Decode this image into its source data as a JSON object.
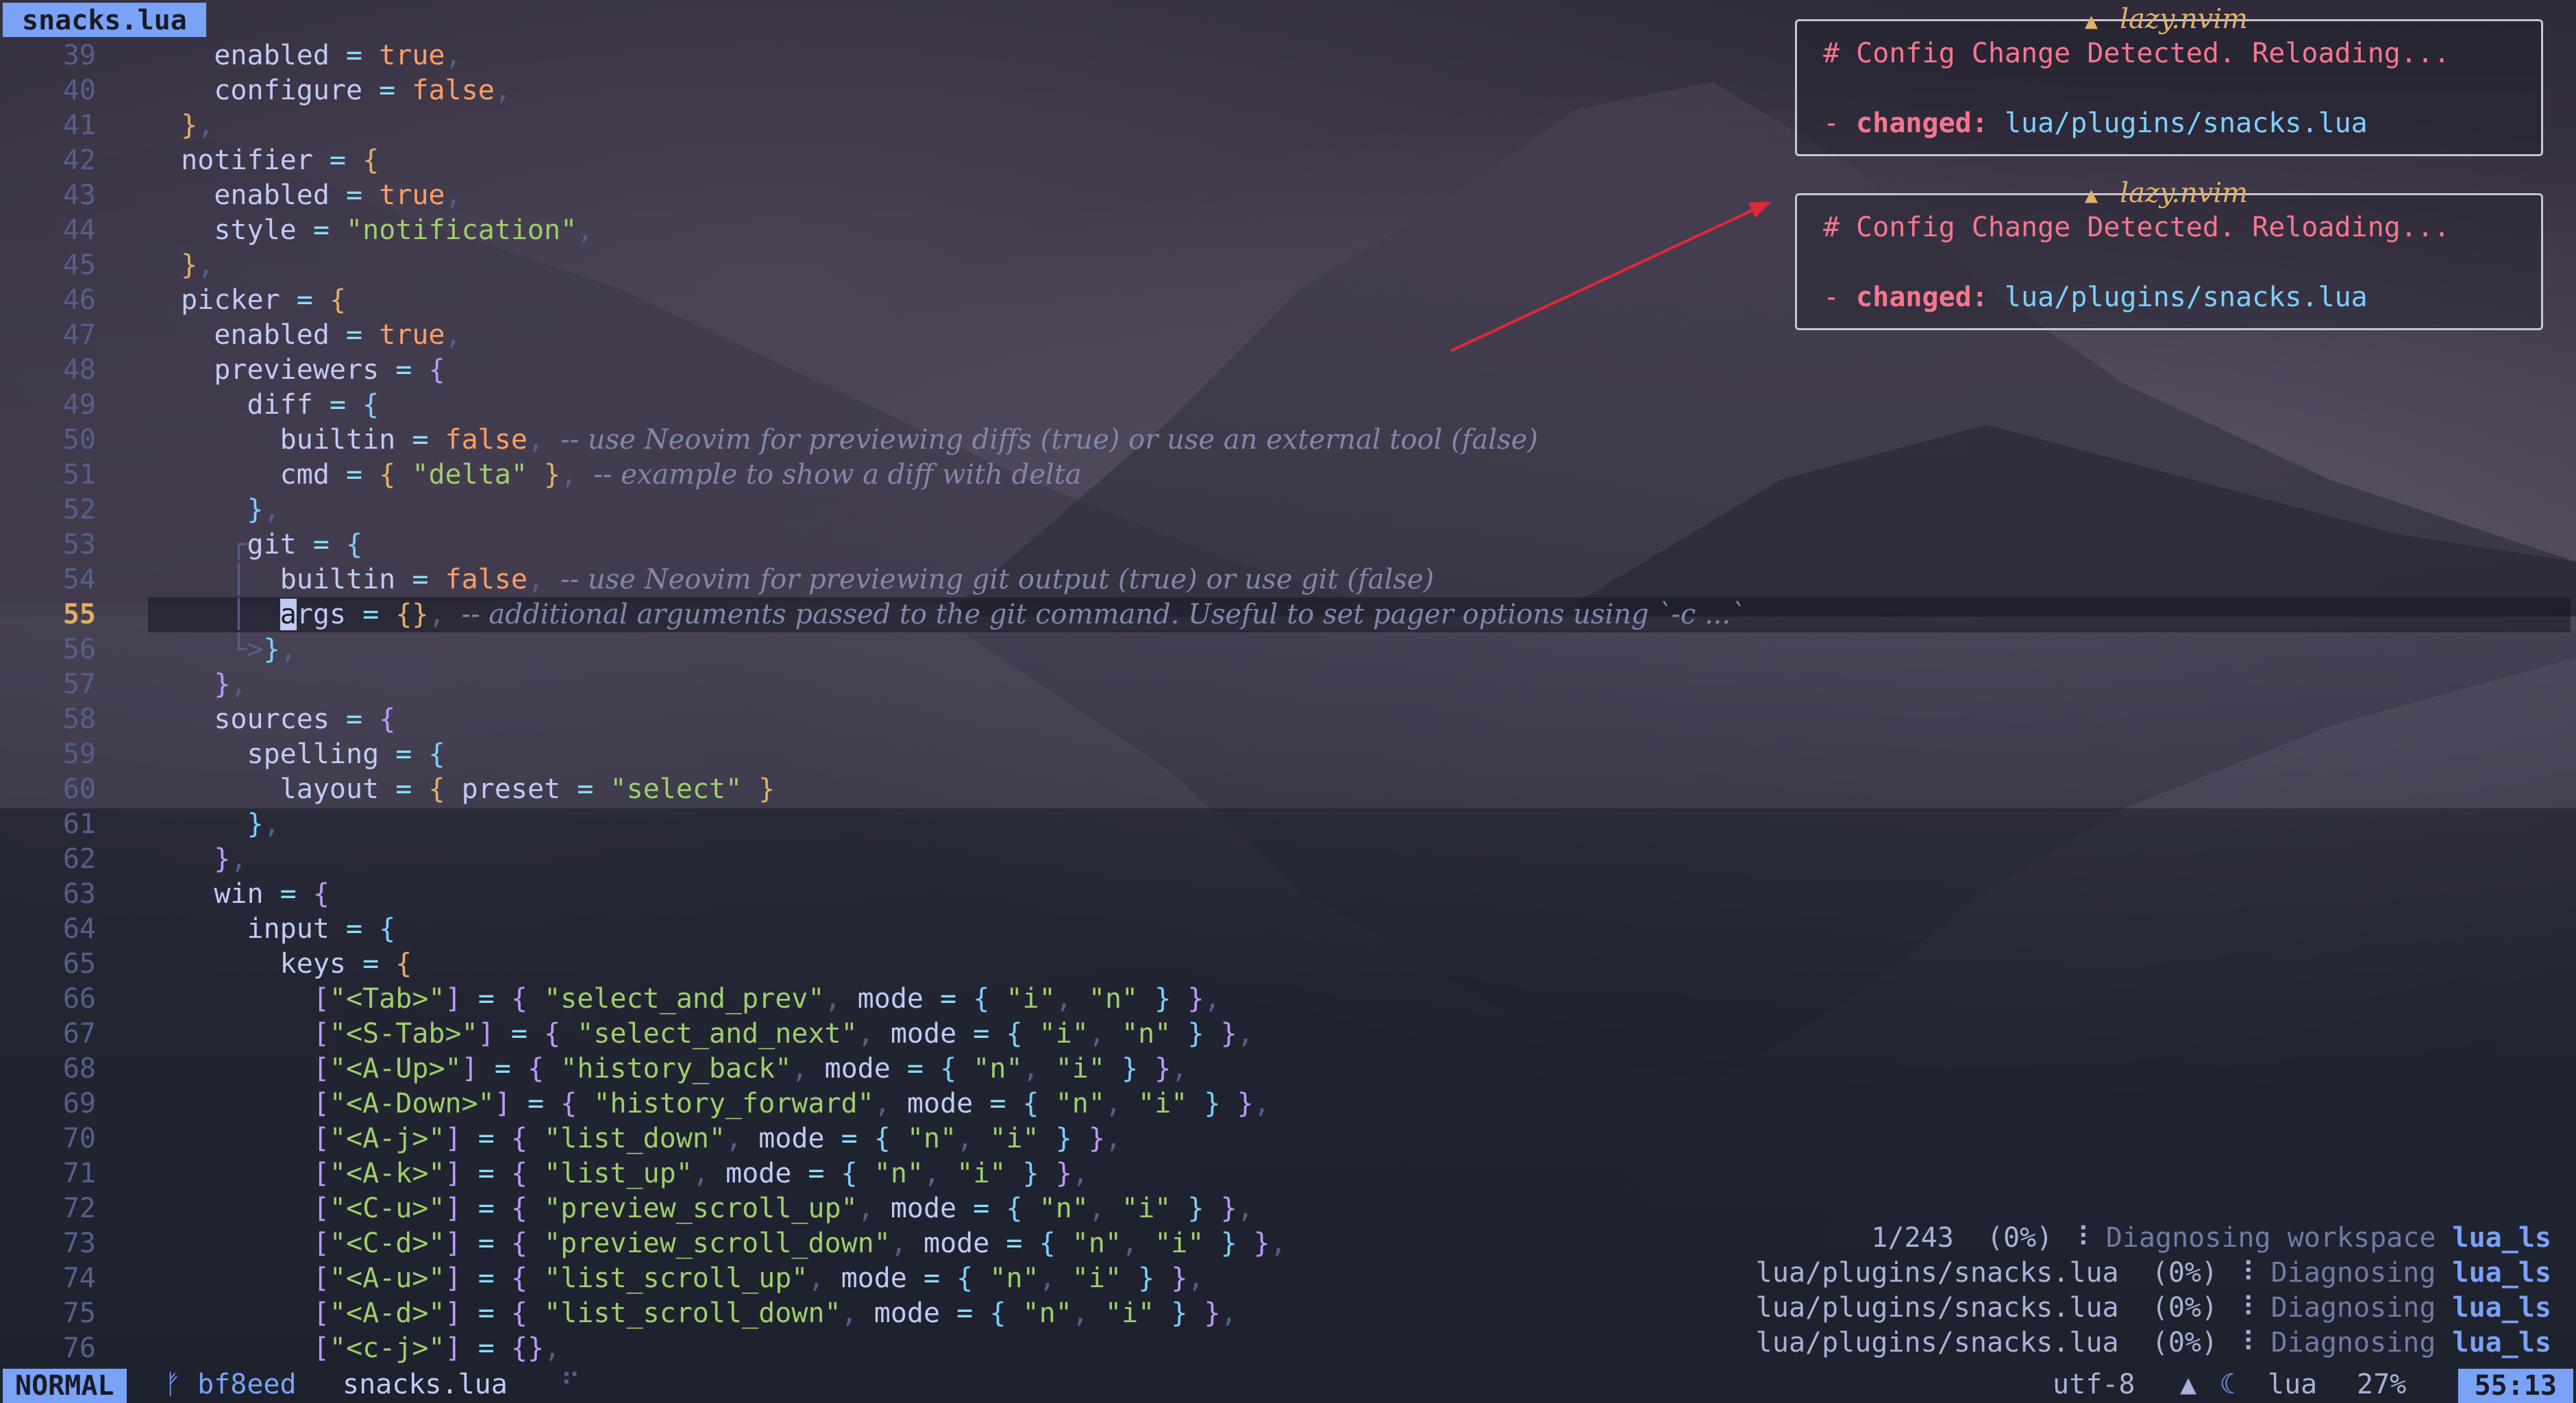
{
  "tabline": {
    "active_tab": "snacks.lua"
  },
  "editor": {
    "cursor_line": 55,
    "lines": [
      {
        "n": "39"
      },
      {
        "n": "40"
      },
      {
        "n": "41"
      },
      {
        "n": "42"
      },
      {
        "n": "43"
      },
      {
        "n": "44"
      },
      {
        "n": "45"
      },
      {
        "n": "46"
      },
      {
        "n": "47"
      },
      {
        "n": "48"
      },
      {
        "n": "49"
      },
      {
        "n": "50"
      },
      {
        "n": "51"
      },
      {
        "n": "52"
      },
      {
        "n": "53"
      },
      {
        "n": "54"
      },
      {
        "n": "55"
      },
      {
        "n": "56"
      },
      {
        "n": "57"
      },
      {
        "n": "58"
      },
      {
        "n": "59"
      },
      {
        "n": "60"
      },
      {
        "n": "61"
      },
      {
        "n": "62"
      },
      {
        "n": "63"
      },
      {
        "n": "64"
      },
      {
        "n": "65"
      },
      {
        "n": "66"
      },
      {
        "n": "67"
      },
      {
        "n": "68"
      },
      {
        "n": "69"
      },
      {
        "n": "70"
      },
      {
        "n": "71"
      },
      {
        "n": "72"
      },
      {
        "n": "73"
      },
      {
        "n": "74"
      },
      {
        "n": "75"
      },
      {
        "n": "76"
      }
    ],
    "text": {
      "l39": "enabled",
      "l39v": "true",
      "l40": "configure",
      "l40v": "false",
      "l42": "notifier",
      "l43": "enabled",
      "l43v": "true",
      "l44": "style",
      "l44v": "\"notification\"",
      "l46": "picker",
      "l47": "enabled",
      "l47v": "true",
      "l48": "previewers",
      "l49": "diff",
      "l50": "builtin",
      "l50v": "false",
      "l50c": "-- use Neovim for previewing diffs (true) or use an external tool (false)",
      "l51": "cmd",
      "l51v": "\"delta\"",
      "l51c": "-- example to show a diff with delta",
      "l53": "git",
      "l54": "builtin",
      "l54v": "false",
      "l54c": "-- use Neovim for previewing git output (true) or use git (false)",
      "l55a": "a",
      "l55": "rgs",
      "l55c": "-- additional arguments passed to the git command. Useful to set pager options using `-c ...`",
      "l58": "sources",
      "l59": "spelling",
      "l60": "layout",
      "l60k": "preset",
      "l60v": "\"select\"",
      "l63": "win",
      "l64": "input",
      "l65": "keys",
      "l66k": "\"<Tab>\"",
      "l66v": "\"select_and_prev\"",
      "l67k": "\"<S-Tab>\"",
      "l67v": "\"select_and_next\"",
      "l68k": "\"<A-Up>\"",
      "l68v": "\"history_back\"",
      "l69k": "\"<A-Down>\"",
      "l69v": "\"history_forward\"",
      "l70k": "\"<A-j>\"",
      "l70v": "\"list_down\"",
      "l71k": "\"<A-k>\"",
      "l71v": "\"list_up\"",
      "l72k": "\"<C-u>\"",
      "l72v": "\"preview_scroll_up\"",
      "l73k": "\"<C-d>\"",
      "l73v": "\"preview_scroll_down\"",
      "l74k": "\"<A-u>\"",
      "l74v": "\"list_scroll_up\"",
      "l75k": "\"<A-d>\"",
      "l75v": "\"list_scroll_down\"",
      "l76k": "\"<c-j>\"",
      "mode": "mode",
      "i": "\"i\"",
      "n": "\"n\""
    }
  },
  "notifications": [
    {
      "title": "lazy.nvim",
      "icon": "warning-icon",
      "heading": "# Config Change Detected. Reloading...",
      "label": "changed:",
      "path": "lua/plugins/snacks.lua"
    },
    {
      "title": "lazy.nvim",
      "icon": "warning-icon",
      "heading": "# Config Change Detected. Reloading...",
      "label": "changed:",
      "path": "lua/plugins/snacks.lua"
    }
  ],
  "lsp_progress": [
    {
      "main": "1/243  (0%)",
      "spinner": "⠸",
      "msg": "Diagnosing workspace",
      "client": "lua_ls"
    },
    {
      "main": "lua/plugins/snacks.lua  (0%)",
      "spinner": "⠸",
      "msg": "Diagnosing",
      "client": "lua_ls"
    },
    {
      "main": "lua/plugins/snacks.lua  (0%)",
      "spinner": "⠸",
      "msg": "Diagnosing",
      "client": "lua_ls"
    },
    {
      "main": "lua/plugins/snacks.lua  (0%)",
      "spinner": "⠸",
      "msg": "Diagnosing",
      "client": "lua_ls"
    }
  ],
  "statusline": {
    "mode": "NORMAL",
    "branch_icon": "git-branch-icon",
    "branch": "bf8eed",
    "filename": "snacks.lua",
    "modified_marker": "⠋",
    "encoding": "utf-8",
    "os_icon": "linux-icon",
    "filetype_icon": "lua-icon",
    "filetype": "lua",
    "percent": "27%",
    "position": "55:13"
  },
  "colors": {
    "accent": "#7aa2f7",
    "annotation_arrow": "#e0283a"
  }
}
